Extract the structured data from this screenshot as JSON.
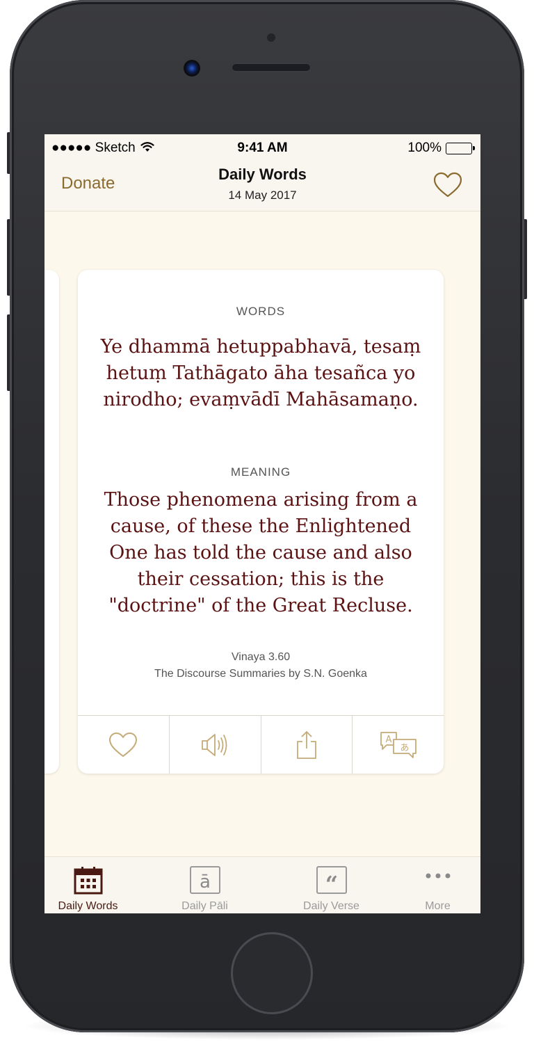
{
  "status_bar": {
    "carrier": "●●●●● Sketch",
    "time": "9:41 AM",
    "battery": "100%",
    "battery_level": 1.0
  },
  "nav": {
    "donate_label": "Donate",
    "title": "Daily Words",
    "subtitle": "14 May 2017",
    "favorite_icon": "heart-outline-icon"
  },
  "card": {
    "words_label": "WORDS",
    "words_text": "Ye dhammā hetuppabhavā, tesaṃ hetuṃ Tathāgato āha tesañca yo nirodho; evaṃvādī Mahāsamaṇo.",
    "meaning_label": "MEANING",
    "meaning_text": "Those phenomena arising from a cause, of these the Enlightened One has told the cause and also their cessation; this is the \"doctrine\" of the Great Recluse.",
    "source_ref": "Vinaya 3.60",
    "source_book": "The Discourse Summaries by S.N. Goenka",
    "actions": [
      "heart-icon",
      "speaker-icon",
      "share-icon",
      "translate-icon"
    ]
  },
  "tabs": [
    {
      "label": "Daily Words",
      "icon": "calendar-icon",
      "active": true
    },
    {
      "label": "Daily Pāli",
      "icon": "pali-a-icon",
      "active": false
    },
    {
      "label": "Daily Verse",
      "icon": "quote-icon",
      "active": false
    },
    {
      "label": "More",
      "icon": "more-dots-icon",
      "active": false
    }
  ],
  "colors": {
    "accent_gold": "#8b6a2e",
    "text_maroon": "#5a1212",
    "background": "#fdf8ec"
  }
}
